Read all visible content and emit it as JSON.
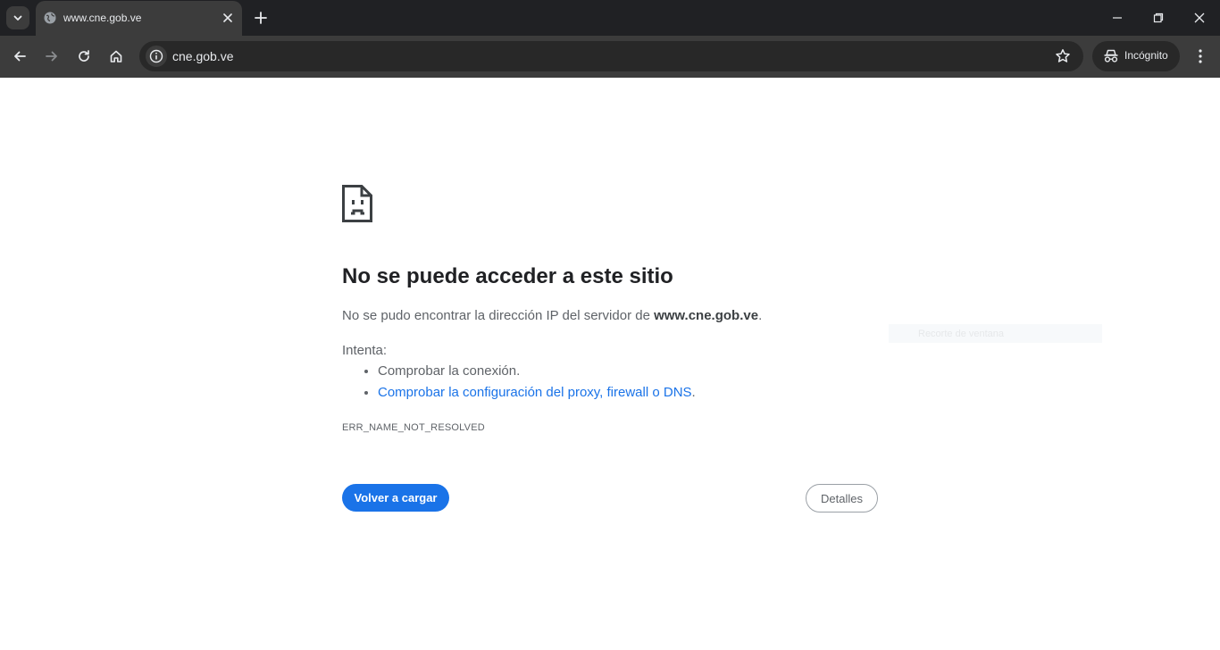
{
  "browser": {
    "tab": {
      "title": "www.cne.gob.ve",
      "favicon": "globe-icon"
    },
    "omnibox": {
      "url": "cne.gob.ve"
    },
    "incognito_label": "Incógnito",
    "colors": {
      "tabstrip": "#202124",
      "toolbar": "#3c3c3c",
      "omnibox": "#282828"
    }
  },
  "error_page": {
    "icon": "sad-document-icon",
    "heading": "No se puede acceder a este sitio",
    "desc_prefix": "No se pudo encontrar la dirección IP del servidor de ",
    "desc_host": "www.cne.gob.ve",
    "desc_suffix": ".",
    "try_label": "Intenta:",
    "suggestions": [
      {
        "text": "Comprobar la conexión.",
        "link": false
      },
      {
        "text": "Comprobar la configuración del proxy, firewall o DNS",
        "link": true,
        "suffix": "."
      }
    ],
    "error_code": "ERR_NAME_NOT_RESOLVED",
    "reload_label": "Volver a cargar",
    "details_label": "Detalles",
    "overlay_text": "Recorte de ventana",
    "colors": {
      "accent": "#1a73e8",
      "heading": "#202124",
      "text": "#5f6368"
    }
  }
}
